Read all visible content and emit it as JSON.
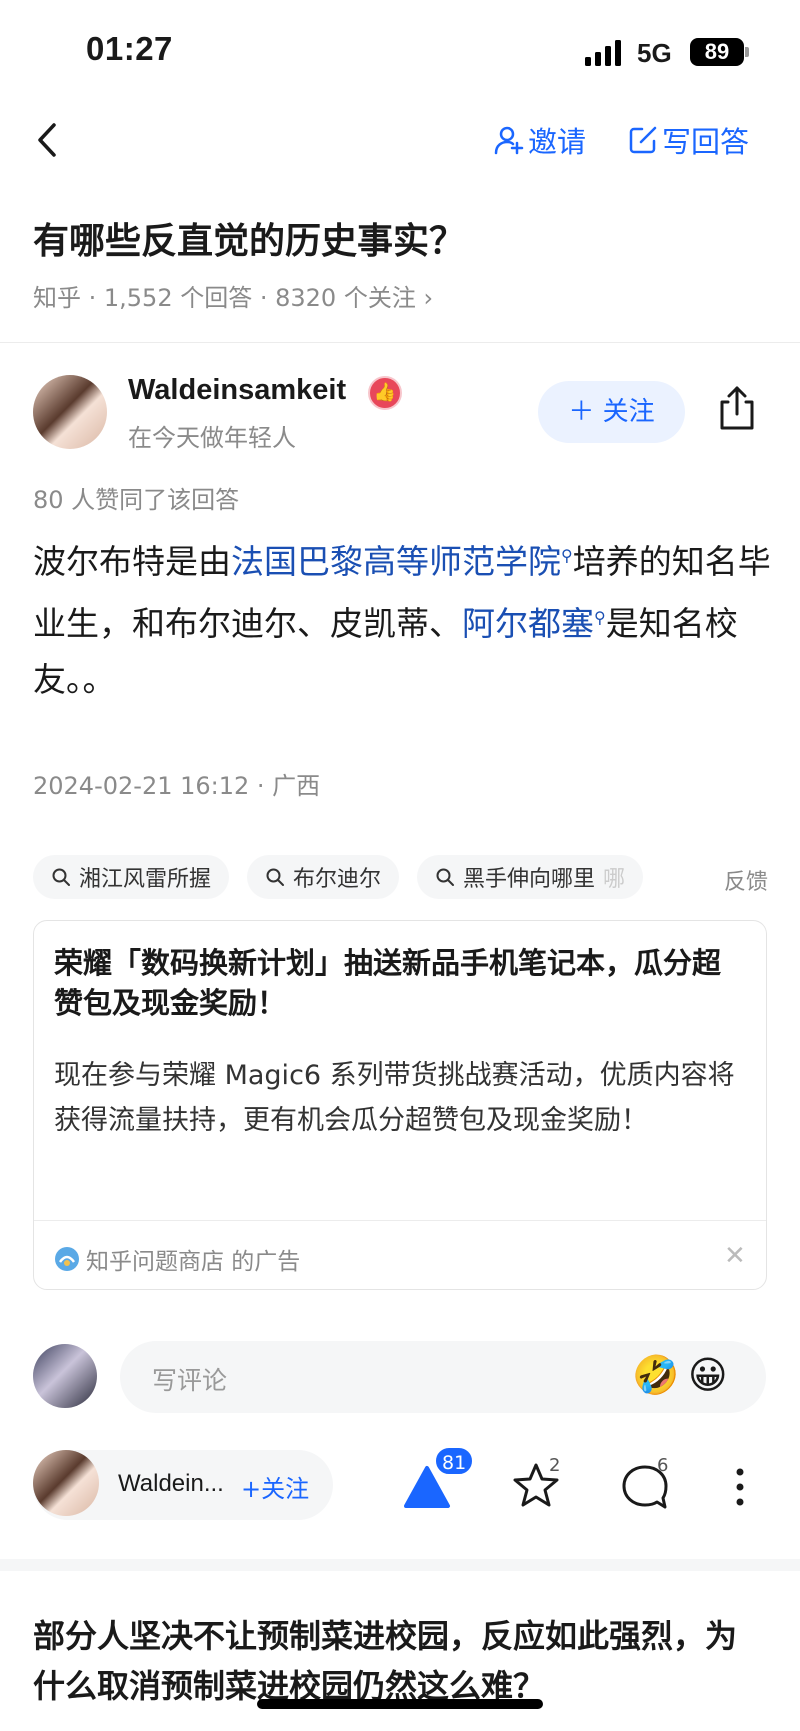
{
  "status": {
    "time": "01:27",
    "network": "5G",
    "battery": "89"
  },
  "nav": {
    "invite_label": "邀请",
    "write_label": "写回答"
  },
  "question": {
    "title": "有哪些反直觉的历史事实？",
    "meta": "知乎 · 1,552 个回答 · 8320 个关注 ›"
  },
  "author": {
    "name": "Waldeinsamkeit",
    "bio": "在今天做年轻人",
    "follow_label": "关注"
  },
  "answer": {
    "agree_text": "80 人赞同了该回答",
    "part1": "波尔布特是由",
    "link1": "法国巴黎高等师范学院",
    "part2": "培养的知名毕业生，和布尔迪尔、皮凯蒂、",
    "link2": "阿尔都塞",
    "part3": "是知名校友。。",
    "date": "2024-02-21 16:12 · 广西"
  },
  "tags": [
    "湘江风雷所握",
    "布尔迪尔",
    "黑手伸向哪里"
  ],
  "tag_cut": "哪",
  "feedback_label": "反馈",
  "ad": {
    "title": "荣耀「数码换新计划」抽送新品手机笔记本，瓜分超赞包及现金奖励！",
    "body": "现在参与荣耀 Magic6 系列带货挑战赛活动，优质内容将获得流量扶持，更有机会瓜分超赞包及现金奖励！",
    "source": "知乎问题商店 的广告"
  },
  "comment": {
    "placeholder": "写评论",
    "emoji1": "🤣",
    "emoji2": "😀"
  },
  "bottom": {
    "author_short": "Waldein...",
    "follow_label": "+关注",
    "votes": "81",
    "favorites": "2",
    "comments": "6"
  },
  "next_question": {
    "title": "部分人坚决不让预制菜进校园，反应如此强烈，为什么取消预制菜进校园仍然这么难？"
  },
  "colors": {
    "accent": "#1a66ff",
    "link": "#1a4fb3",
    "muted": "#8a8a8a"
  }
}
